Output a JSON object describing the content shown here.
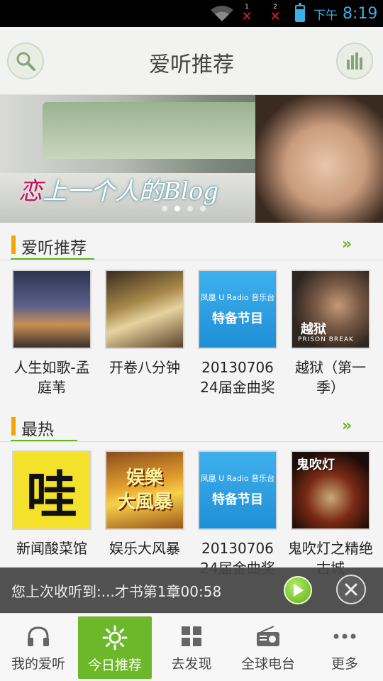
{
  "status_bar": {
    "sim1_number": "1",
    "sim2_number": "2",
    "sim_error_glyph": "✕",
    "ampm": "下午",
    "time": "8:19",
    "accent_color": "#3ab0e8"
  },
  "header": {
    "title": "爱听推荐",
    "left_icon": "search-icon",
    "right_icon": "equalizer-icon"
  },
  "banner": {
    "caption_first": "恋",
    "caption_rest": "上一个人的Blog",
    "dot_count": 4,
    "active_dot": 1
  },
  "sections": [
    {
      "title": "爱听推荐",
      "more_icon": "double-chevron-right-icon",
      "items": [
        {
          "label": "人生如歌-孟庭苇",
          "thumb": "road-night"
        },
        {
          "label": "开卷八分钟",
          "thumb": "book-program"
        },
        {
          "label": "20130706 24届金曲奖",
          "thumb": "radio-special",
          "thumb_text_1": "凤凰 U Radio 音乐台",
          "thumb_text_2": "特备节目"
        },
        {
          "label": "越狱（第一季）",
          "thumb": "prison-break",
          "thumb_text_1": "越狱",
          "thumb_text_2": "PRISON BREAK"
        }
      ]
    },
    {
      "title": "最热",
      "more_icon": "double-chevron-right-icon",
      "items": [
        {
          "label": "新闻酸菜馆",
          "thumb": "wa",
          "thumb_text_1": "哇"
        },
        {
          "label": "娱乐大风暴",
          "thumb": "entertainment",
          "thumb_text_1": "娱樂",
          "thumb_text_2": "大風暴"
        },
        {
          "label": "20130706 24届金曲奖",
          "thumb": "radio-special",
          "thumb_text_1": "凤凰 U Radio 音乐台",
          "thumb_text_2": "特备节目"
        },
        {
          "label": "鬼吹灯之精绝古城",
          "thumb": "ghost-lamp",
          "thumb_text_1": "鬼吹灯"
        }
      ]
    }
  ],
  "now_playing": {
    "text": "您上次收听到:...才书第1章00:58",
    "play_icon": "play-icon",
    "close_icon": "close-icon"
  },
  "bottom_nav": {
    "active_index": 1,
    "accent_color": "#6cb82a",
    "items": [
      {
        "label": "我的爱听",
        "icon": "headphones-icon"
      },
      {
        "label": "今日推荐",
        "icon": "sun-icon"
      },
      {
        "label": "去发现",
        "icon": "grid-icon"
      },
      {
        "label": "全球电台",
        "icon": "radio-icon"
      },
      {
        "label": "更多",
        "icon": "more-dots-icon"
      }
    ]
  }
}
